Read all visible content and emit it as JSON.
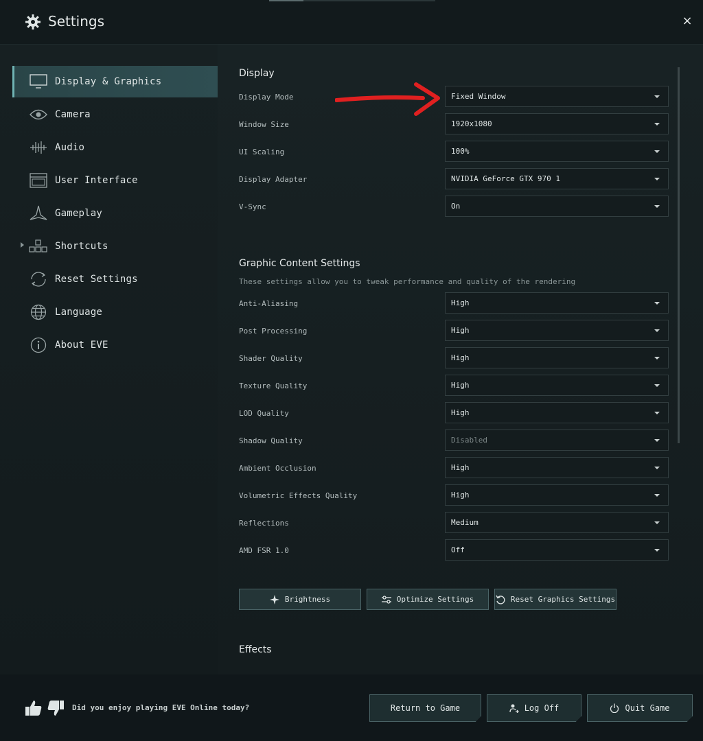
{
  "window": {
    "title": "Settings",
    "title_icon": "gear-icon",
    "close_label": "×"
  },
  "sidebar": {
    "items": [
      {
        "label": "Display & Graphics",
        "icon": "monitor-icon",
        "active": true
      },
      {
        "label": "Camera",
        "icon": "eye-icon"
      },
      {
        "label": "Audio",
        "icon": "audio-wave-icon"
      },
      {
        "label": "User Interface",
        "icon": "window-icon"
      },
      {
        "label": "Gameplay",
        "icon": "ship-icon"
      },
      {
        "label": "Shortcuts",
        "icon": "shortcuts-icon",
        "expandable": true
      },
      {
        "label": "Reset Settings",
        "icon": "reset-icon"
      },
      {
        "label": "Language",
        "icon": "globe-icon"
      },
      {
        "label": "About EVE",
        "icon": "info-icon"
      }
    ]
  },
  "display": {
    "title": "Display",
    "rows": [
      {
        "label": "Display Mode",
        "value": "Fixed Window"
      },
      {
        "label": "Window Size",
        "value": "1920x1080"
      },
      {
        "label": "UI Scaling",
        "value": "100%"
      },
      {
        "label": "Display Adapter",
        "value": "NVIDIA GeForce GTX 970 1"
      },
      {
        "label": "V-Sync",
        "value": "On"
      }
    ]
  },
  "graphic": {
    "title": "Graphic Content Settings",
    "subtitle": "These settings allow you to tweak performance and quality of the rendering",
    "rows": [
      {
        "label": "Anti-Aliasing",
        "value": "High"
      },
      {
        "label": "Post Processing",
        "value": "High"
      },
      {
        "label": "Shader Quality",
        "value": "High"
      },
      {
        "label": "Texture Quality",
        "value": "High"
      },
      {
        "label": "LOD Quality",
        "value": "High"
      },
      {
        "label": "Shadow Quality",
        "value": "Disabled",
        "disabled": true
      },
      {
        "label": "Ambient Occlusion",
        "value": "High"
      },
      {
        "label": "Volumetric Effects Quality",
        "value": "High"
      },
      {
        "label": "Reflections",
        "value": "Medium"
      },
      {
        "label": "AMD FSR 1.0",
        "value": "Off"
      }
    ]
  },
  "actions": {
    "brightness": "Brightness",
    "optimize": "Optimize Settings",
    "reset_graphics": "Reset Graphics Settings"
  },
  "effects": {
    "title": "Effects"
  },
  "footer": {
    "feedback_text": "Did you enjoy playing EVE Online today?",
    "return_label": "Return to Game",
    "logoff_label": "Log Off",
    "quit_label": "Quit Game"
  },
  "colors": {
    "accent": "#6fb3b3",
    "active_nav_bg": "#2f4e52",
    "annotation_arrow": "#e02020"
  }
}
